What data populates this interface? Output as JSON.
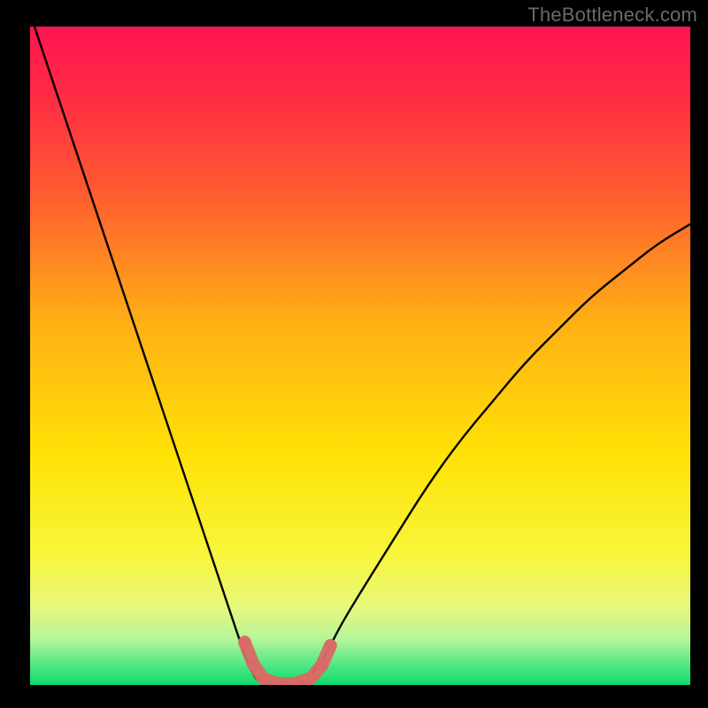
{
  "watermark": "TheBottleneck.com",
  "chart_data": {
    "type": "line",
    "title": "",
    "xlabel": "",
    "ylabel": "",
    "xlim": [
      0,
      100
    ],
    "ylim": [
      0,
      100
    ],
    "legend": false,
    "grid": false,
    "x": [
      0,
      2,
      4,
      6,
      8,
      10,
      12,
      14,
      16,
      18,
      20,
      22,
      24,
      26,
      28,
      30,
      32,
      33.5,
      35,
      37,
      39,
      41,
      43,
      45,
      47,
      50,
      55,
      60,
      65,
      70,
      75,
      80,
      85,
      90,
      95,
      100
    ],
    "values": [
      102,
      96,
      90,
      84,
      78,
      72,
      66,
      60,
      54,
      48,
      42,
      36,
      30,
      24,
      18,
      12,
      6,
      2,
      0,
      0,
      0,
      0,
      2,
      5,
      9,
      14,
      22,
      30,
      37,
      43,
      49,
      54,
      59,
      63,
      67,
      70
    ],
    "background_gradient": {
      "stops": [
        {
          "pos": 0.0,
          "color": "#ff1450"
        },
        {
          "pos": 0.1,
          "color": "#ff2a45"
        },
        {
          "pos": 0.25,
          "color": "#ff5a30"
        },
        {
          "pos": 0.45,
          "color": "#ffb015"
        },
        {
          "pos": 0.65,
          "color": "#ffe205"
        },
        {
          "pos": 0.8,
          "color": "#f8f53a"
        },
        {
          "pos": 0.88,
          "color": "#e8f87a"
        },
        {
          "pos": 0.93,
          "color": "#b6f59a"
        },
        {
          "pos": 0.97,
          "color": "#4fe884"
        },
        {
          "pos": 1.0,
          "color": "#11d86f"
        }
      ]
    },
    "bottom_markers": {
      "color": "#d96a66",
      "radius": 7,
      "points": [
        {
          "x": 32.5,
          "y": 6.5
        },
        {
          "x": 33.8,
          "y": 3.2
        },
        {
          "x": 35.3,
          "y": 1.0
        },
        {
          "x": 37.5,
          "y": 0.2
        },
        {
          "x": 40.0,
          "y": 0.2
        },
        {
          "x": 42.5,
          "y": 1.0
        },
        {
          "x": 44.2,
          "y": 3.0
        },
        {
          "x": 45.5,
          "y": 6.0
        }
      ]
    }
  }
}
